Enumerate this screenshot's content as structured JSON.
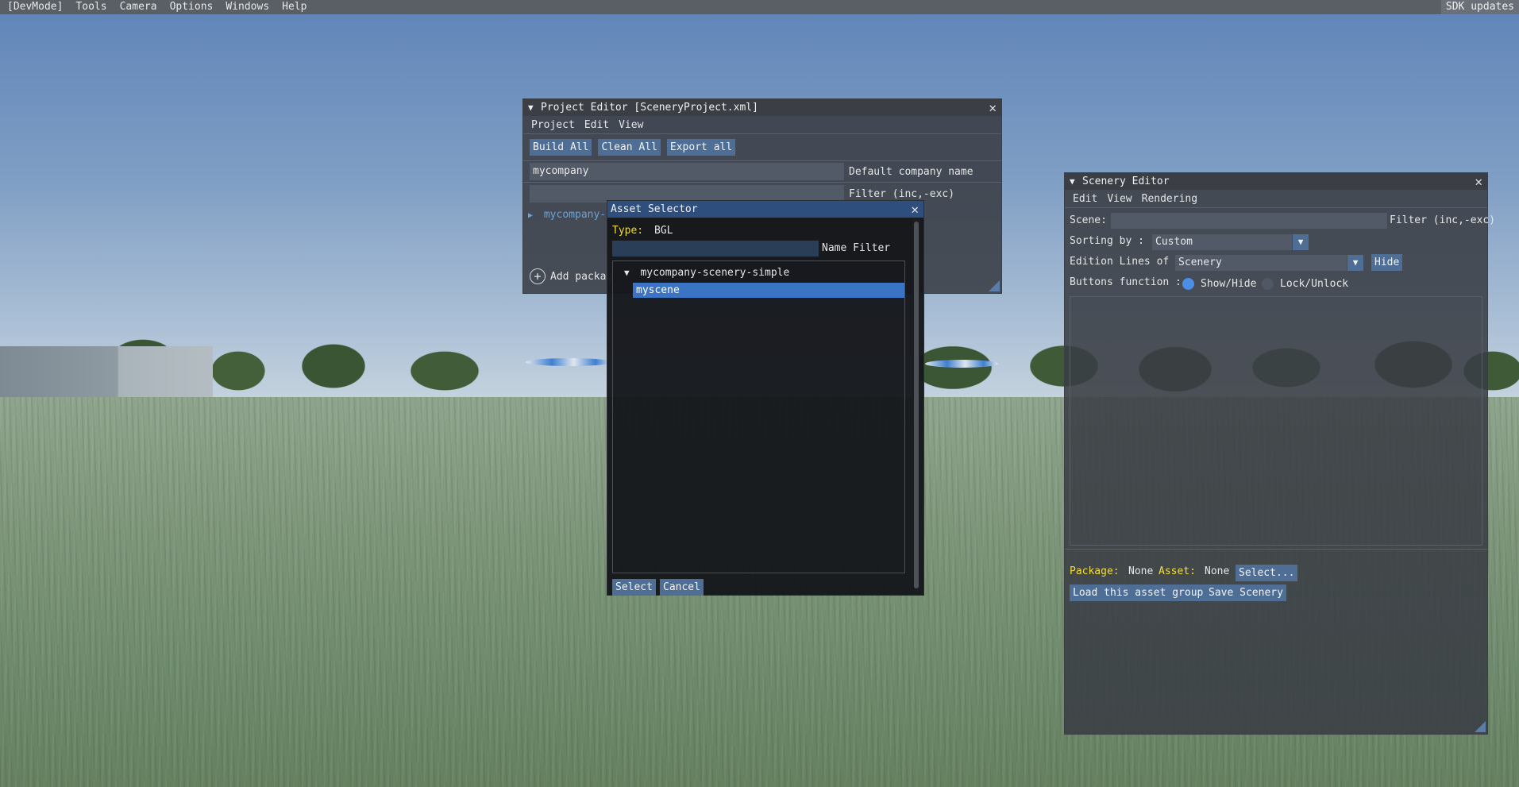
{
  "menubar": {
    "items": [
      "[DevMode]",
      "Tools",
      "Camera",
      "Options",
      "Windows",
      "Help"
    ],
    "sdk_updates": "SDK updates"
  },
  "project_editor": {
    "title": "Project Editor [SceneryProject.xml]",
    "menu": [
      "Project",
      "Edit",
      "View"
    ],
    "buttons": {
      "build_all": "Build All",
      "clean_all": "Clean All",
      "export_all": "Export all"
    },
    "company_value": "mycompany",
    "company_label": "Default company name",
    "filter_label": "Filter (inc,-exc)",
    "tree_item": "mycompany-",
    "add_package": "Add packag"
  },
  "scenery_editor": {
    "title": "Scenery Editor",
    "menu": [
      "Edit",
      "View",
      "Rendering"
    ],
    "scene_label": "Scene:",
    "filter_label": "Filter (inc,-exc)",
    "sorting_label": "Sorting by :",
    "sorting_value": "Custom",
    "edition_label": "Edition Lines of",
    "edition_value": "Scenery",
    "hide_button": "Hide",
    "buttons_function_label": "Buttons function :",
    "radio_show_hide": "Show/Hide",
    "radio_lock_unlock": "Lock/Unlock",
    "package_label": "Package:",
    "package_value": "None",
    "asset_label": "Asset:",
    "asset_value": "None",
    "select_button": "Select...",
    "load_group_button": "Load this asset group",
    "save_scenery_button": "Save Scenery"
  },
  "asset_selector": {
    "title": "Asset Selector",
    "type_label": "Type:",
    "type_value": "BGL",
    "name_filter_label": "Name Filter",
    "name_filter_value": "",
    "tree_parent": "mycompany-scenery-simple",
    "tree_child": "myscene",
    "select_button": "Select",
    "cancel_button": "Cancel"
  },
  "colors": {
    "accent": "#3b74c4",
    "button": "#4f6e96",
    "yellow_label": "#f2dd3a",
    "tree_link": "#69a4d8"
  }
}
